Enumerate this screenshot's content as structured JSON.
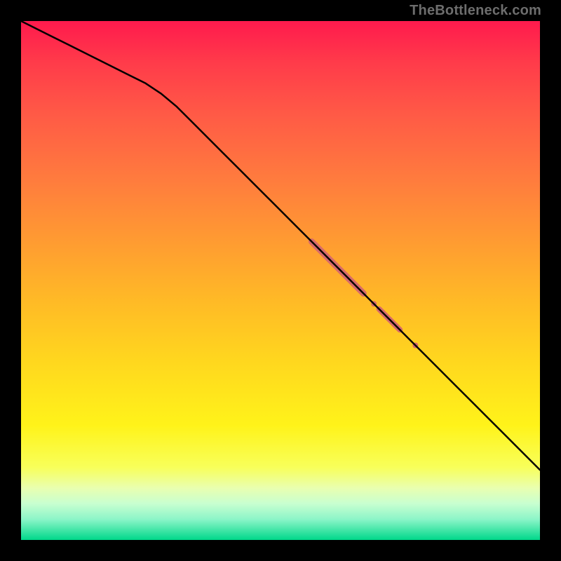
{
  "watermark": "TheBottleneck.com",
  "colors": {
    "line": "#000000",
    "marker": "#d66a6a",
    "plot_bg_top": "#ff1a4d",
    "plot_bg_bottom": "#00d88a",
    "frame": "#000000"
  },
  "chart_data": {
    "type": "line",
    "title": "",
    "xlabel": "",
    "ylabel": "",
    "xlim": [
      0,
      100
    ],
    "ylim": [
      0,
      100
    ],
    "x": [
      0,
      3,
      6,
      9,
      12,
      15,
      18,
      21,
      24,
      27,
      30,
      33,
      36,
      39,
      42,
      45,
      48,
      51,
      54,
      57,
      60,
      63,
      66,
      69,
      72,
      75,
      78,
      81,
      84,
      87,
      90,
      93,
      96,
      100
    ],
    "series": [
      {
        "name": "curve",
        "values": [
          100,
          98.5,
          97,
          95.5,
          94,
          92.5,
          91,
          89.5,
          88,
          86,
          83.5,
          80.5,
          77.5,
          74.5,
          71.5,
          68.5,
          65.5,
          62.5,
          59.5,
          56.5,
          53.5,
          50.5,
          47.5,
          44.5,
          41.5,
          38.5,
          35.5,
          32.5,
          29.5,
          26.5,
          23.5,
          20.5,
          17.5,
          13.5
        ]
      }
    ],
    "highlights": [
      {
        "type": "thick_segment",
        "x0": 56,
        "x1": 66,
        "thickness": 9
      },
      {
        "type": "dot",
        "x": 68,
        "r": 4
      },
      {
        "type": "thick_segment",
        "x0": 69,
        "x1": 73,
        "thickness": 8
      },
      {
        "type": "dot",
        "x": 76,
        "r": 4
      }
    ]
  }
}
